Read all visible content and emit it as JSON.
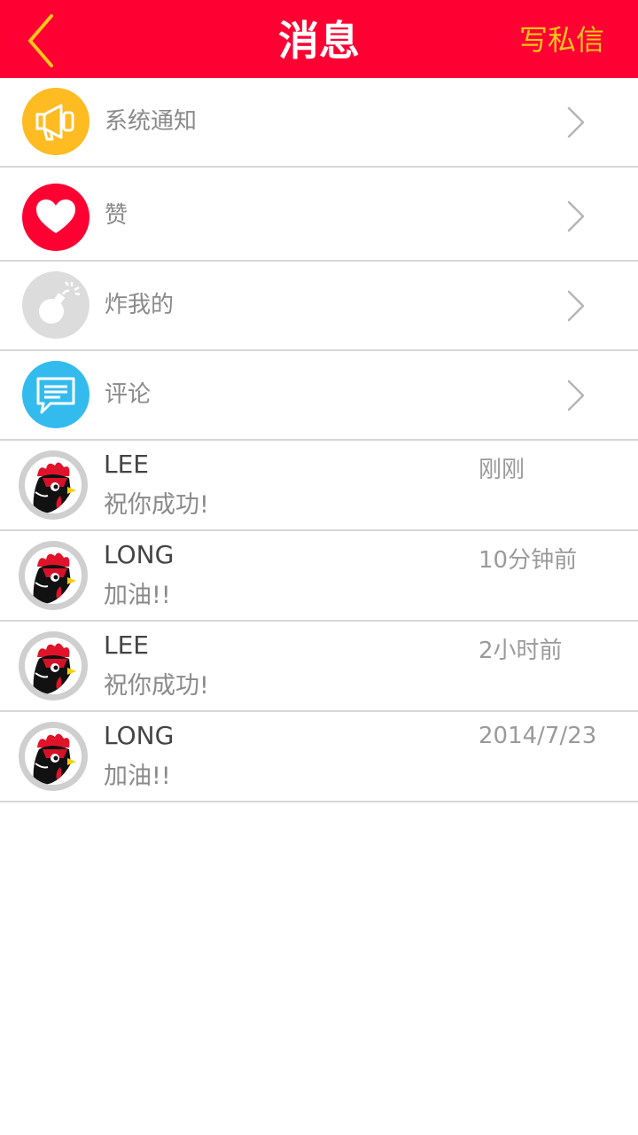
{
  "header": {
    "title": "消息",
    "write_label": "写私信",
    "bg_color": "#ff0033",
    "accent_color": "#ffc61a"
  },
  "categories": [
    {
      "label": "系统通知",
      "icon": "megaphone-icon",
      "color": "#ffbb22"
    },
    {
      "label": "赞",
      "icon": "heart-icon",
      "color": "#ff0033"
    },
    {
      "label": "炸我的",
      "icon": "bomb-icon",
      "color": "#dcdcdc"
    },
    {
      "label": "评论",
      "icon": "comment-icon",
      "color": "#33bbee"
    }
  ],
  "messages": [
    {
      "name": "LEE",
      "text": "祝你成功!",
      "time": "刚刚"
    },
    {
      "name": "LONG",
      "text": "加油!!",
      "time": "10分钟前"
    },
    {
      "name": "LEE",
      "text": "祝你成功!",
      "time": "2小时前"
    },
    {
      "name": "LONG",
      "text": "加油!!",
      "time": "2014/7/23"
    }
  ]
}
